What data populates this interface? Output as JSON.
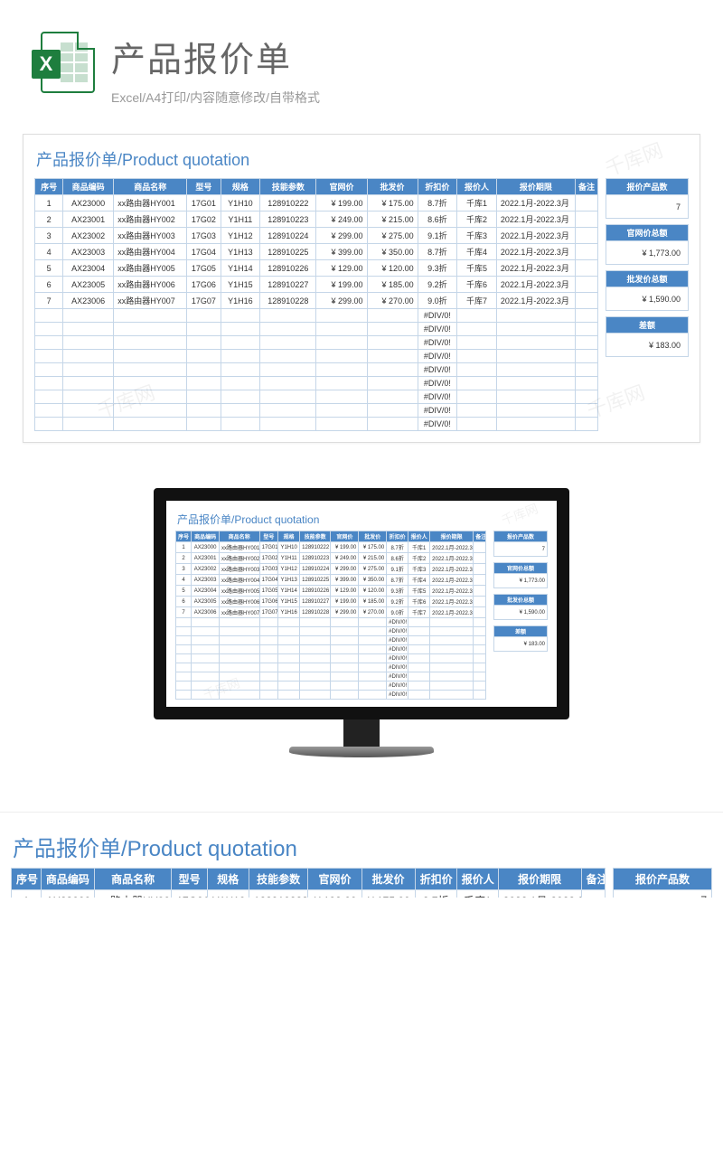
{
  "header": {
    "page_title": "产品报价单",
    "subtitle": "Excel/A4打印/内容随意修改/自带格式",
    "icon_letter": "X"
  },
  "sheet": {
    "title": "产品报价单/Product quotation",
    "columns": [
      "序号",
      "商品编码",
      "商品名称",
      "型号",
      "规格",
      "技能参数",
      "官网价",
      "批发价",
      "折扣价",
      "报价人",
      "报价期限",
      "备注"
    ],
    "rows": [
      {
        "no": "1",
        "code": "AX23000",
        "name": "xx路由器HY001",
        "model": "17G01",
        "spec": "Y1H10",
        "param": "128910222",
        "web": "¥  199.00",
        "whole": "¥  175.00",
        "disc": "8.7折",
        "person": "千库1",
        "period": "2022.1月-2022.3月",
        "note": ""
      },
      {
        "no": "2",
        "code": "AX23001",
        "name": "xx路由器HY002",
        "model": "17G02",
        "spec": "Y1H11",
        "param": "128910223",
        "web": "¥  249.00",
        "whole": "¥  215.00",
        "disc": "8.6折",
        "person": "千库2",
        "period": "2022.1月-2022.3月",
        "note": ""
      },
      {
        "no": "3",
        "code": "AX23002",
        "name": "xx路由器HY003",
        "model": "17G03",
        "spec": "Y1H12",
        "param": "128910224",
        "web": "¥  299.00",
        "whole": "¥  275.00",
        "disc": "9.1折",
        "person": "千库3",
        "period": "2022.1月-2022.3月",
        "note": ""
      },
      {
        "no": "4",
        "code": "AX23003",
        "name": "xx路由器HY004",
        "model": "17G04",
        "spec": "Y1H13",
        "param": "128910225",
        "web": "¥  399.00",
        "whole": "¥  350.00",
        "disc": "8.7折",
        "person": "千库4",
        "period": "2022.1月-2022.3月",
        "note": ""
      },
      {
        "no": "5",
        "code": "AX23004",
        "name": "xx路由器HY005",
        "model": "17G05",
        "spec": "Y1H14",
        "param": "128910226",
        "web": "¥  129.00",
        "whole": "¥  120.00",
        "disc": "9.3折",
        "person": "千库5",
        "period": "2022.1月-2022.3月",
        "note": ""
      },
      {
        "no": "6",
        "code": "AX23005",
        "name": "xx路由器HY006",
        "model": "17G06",
        "spec": "Y1H15",
        "param": "128910227",
        "web": "¥  199.00",
        "whole": "¥  185.00",
        "disc": "9.2折",
        "person": "千库6",
        "period": "2022.1月-2022.3月",
        "note": ""
      },
      {
        "no": "7",
        "code": "AX23006",
        "name": "xx路由器HY007",
        "model": "17G07",
        "spec": "Y1H16",
        "param": "128910228",
        "web": "¥  299.00",
        "whole": "¥  270.00",
        "disc": "9.0折",
        "person": "千库7",
        "period": "2022.1月-2022.3月",
        "note": ""
      }
    ],
    "error_text": "#DIV/0!",
    "empty_rows": 9
  },
  "summary": {
    "count_label": "报价产品数",
    "count_value": "7",
    "web_total_label": "官网价总额",
    "web_total_value": "¥      1,773.00",
    "whole_total_label": "批发价总额",
    "whole_total_value": "¥      1,590.00",
    "diff_label": "差额",
    "diff_value": "¥         183.00"
  },
  "watermark_text": "千库网"
}
